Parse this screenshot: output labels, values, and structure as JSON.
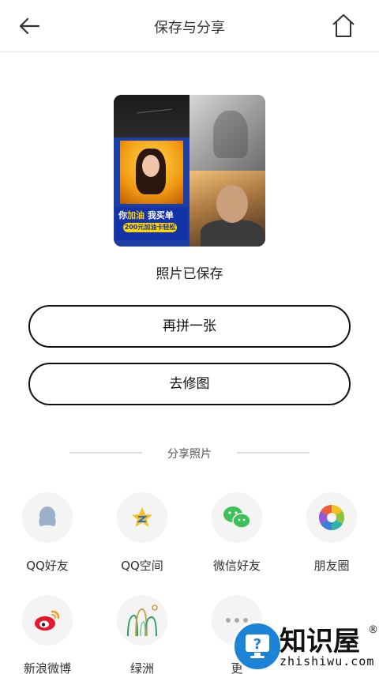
{
  "header": {
    "title": "保存与分享",
    "back_icon": "back-arrow-icon",
    "home_icon": "home-icon"
  },
  "preview": {
    "saved_text": "照片已保存",
    "poster_line1_a": "你",
    "poster_line1_b": "加油",
    "poster_line1_c": " 我买单",
    "poster_line2": "200元加油卡轻松拿"
  },
  "actions": {
    "again_label": "再拼一张",
    "edit_label": "去修图"
  },
  "share": {
    "title": "分享照片",
    "items": [
      {
        "label": "QQ好友",
        "icon": "qq-icon"
      },
      {
        "label": "QQ空间",
        "icon": "qzone-star-icon"
      },
      {
        "label": "微信好友",
        "icon": "wechat-icon"
      },
      {
        "label": "朋友圈",
        "icon": "moments-aperture-icon"
      },
      {
        "label": "新浪微博",
        "icon": "weibo-icon"
      },
      {
        "label": "绿洲",
        "icon": "oasis-icon"
      },
      {
        "label": "更",
        "icon": "more-dots-icon"
      }
    ]
  },
  "watermark": {
    "name": "知识屋",
    "reg": "®",
    "url": "zhishiwu.com"
  },
  "colors": {
    "qq": "#9ab0c8",
    "qzone": "#f6c11b",
    "wechat": "#3ec05a",
    "weibo": "#e6162d",
    "oasis": "#2e9f6b",
    "badge": "#1b84d6"
  }
}
